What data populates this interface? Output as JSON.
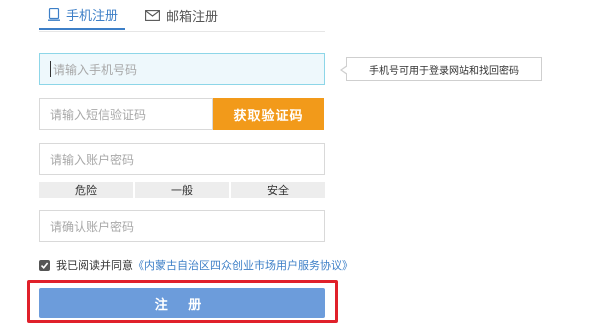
{
  "tabs": [
    {
      "label": "手机注册",
      "icon": "phone-icon",
      "active": true
    },
    {
      "label": "邮箱注册",
      "icon": "envelope-icon",
      "active": false
    }
  ],
  "form": {
    "phone_placeholder": "请输入手机号码",
    "sms_code_placeholder": "请输入短信验证码",
    "get_code_label": "获取验证码",
    "password_placeholder": "请输入账户密码",
    "confirm_placeholder": "请确认账户密码",
    "phone_hint": "手机号可用于登录网站和找回密码"
  },
  "strength": {
    "levels": [
      "危险",
      "一般",
      "安全"
    ]
  },
  "agreement": {
    "prefix": "我已阅读并同意",
    "link": "《内蒙古自治区四众创业市场用户服务协议》",
    "checked": true
  },
  "register_label": "注 册",
  "colors": {
    "accent": "#3d7fc7",
    "get_code_button": "#f29a1a",
    "register_button": "#6c9cdb",
    "highlight_border": "#e0202a"
  }
}
